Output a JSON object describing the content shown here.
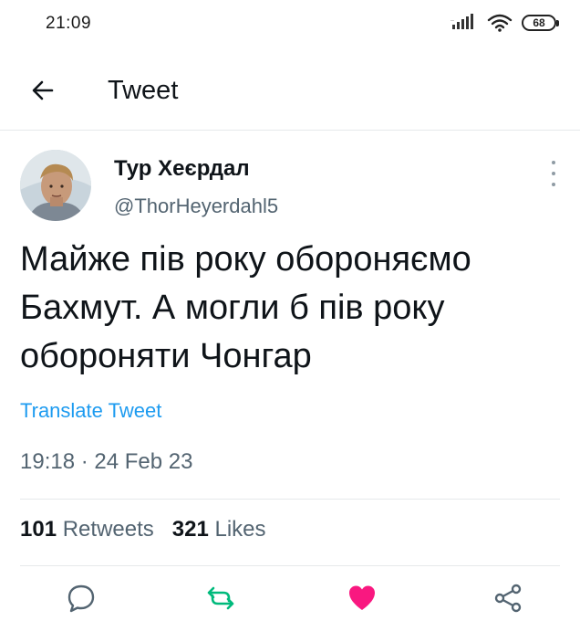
{
  "status_bar": {
    "time": "21:09",
    "battery": "68",
    "icons": [
      "signal-icon",
      "wifi-icon",
      "battery-icon"
    ]
  },
  "header": {
    "title": "Tweet",
    "back_icon": "arrow-left-icon"
  },
  "tweet": {
    "author_name": "Тур Хеєрдал",
    "author_handle": "@ThorHeyerdahl5",
    "text_lines": [
      "Майже пів року обороняємо",
      "Бахмут. А могли б пів року",
      "обороняти Чонгар"
    ],
    "translate_label": "Translate Tweet",
    "timestamp": "19:18 · 24 Feb 23",
    "retweets_count": "101",
    "retweets_label": "Retweets",
    "likes_count": "321",
    "likes_label": "Likes"
  },
  "actions": [
    {
      "name": "reply",
      "icon": "comment-icon"
    },
    {
      "name": "retweet",
      "icon": "retweet-icon",
      "color": "#00ba7c"
    },
    {
      "name": "like",
      "icon": "heart-icon",
      "color": "#f91880",
      "active": true
    },
    {
      "name": "share",
      "icon": "share-icon"
    }
  ],
  "colors": {
    "link": "#1d9bf0",
    "secondary_text": "#536471",
    "retweet_green": "#00ba7c",
    "like_pink": "#f91880"
  }
}
